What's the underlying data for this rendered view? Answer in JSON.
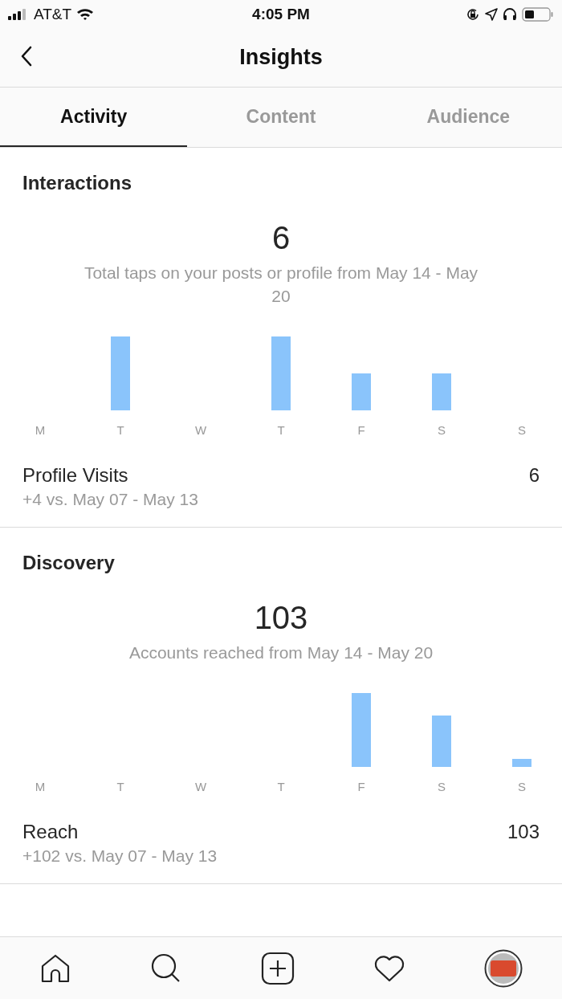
{
  "status_bar": {
    "carrier": "AT&T",
    "time": "4:05 PM"
  },
  "header": {
    "title": "Insights"
  },
  "tabs": [
    {
      "label": "Activity",
      "selected": true
    },
    {
      "label": "Content",
      "selected": false
    },
    {
      "label": "Audience",
      "selected": false
    }
  ],
  "sections": [
    {
      "heading": "Interactions",
      "total": "6",
      "caption": "Total taps on your posts or profile from May 14 - May 20",
      "days": [
        "M",
        "T",
        "W",
        "T",
        "F",
        "S",
        "S"
      ],
      "metric": {
        "label": "Profile Visits",
        "comparison": "+4 vs. May 07 - May 13",
        "value": "6"
      }
    },
    {
      "heading": "Discovery",
      "total": "103",
      "caption": "Accounts reached from May 14 - May 20",
      "days": [
        "M",
        "T",
        "W",
        "T",
        "F",
        "S",
        "S"
      ],
      "metric": {
        "label": "Reach",
        "comparison": "+102 vs. May 07 - May 13",
        "value": "103"
      }
    }
  ]
}
